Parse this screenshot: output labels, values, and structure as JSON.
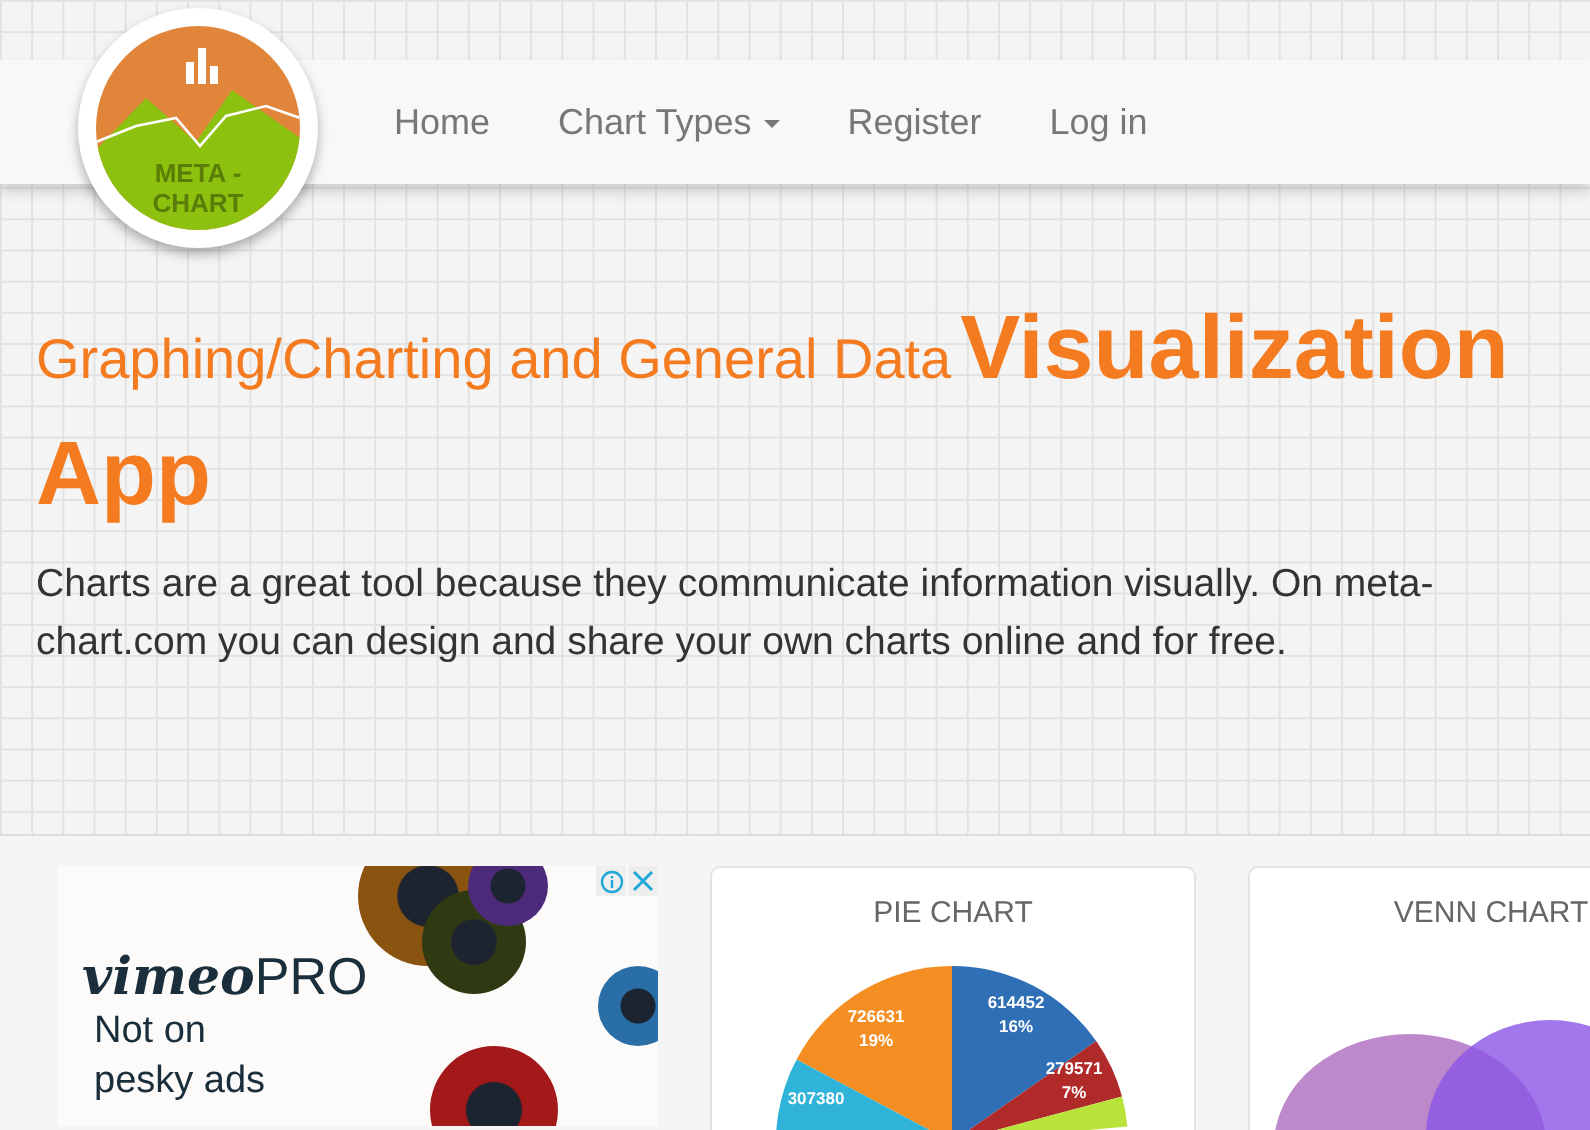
{
  "logo": {
    "text_line_1": "META -",
    "text_line_2": "CHART"
  },
  "nav": [
    {
      "label": "Home",
      "dropdown": false
    },
    {
      "label": "Chart Types",
      "dropdown": true
    },
    {
      "label": "Register",
      "dropdown": false
    },
    {
      "label": "Log in",
      "dropdown": false
    }
  ],
  "hero": {
    "subtitle": "Graphing/Charting and General Data",
    "title": "Visualization App",
    "text": "Charts are a great tool because they communicate information visually. On meta-chart.com you can design and share your own charts online and for free."
  },
  "ad": {
    "brand": "vimeo",
    "brand_suffix": "PRO",
    "text": "Not on pesky ads"
  },
  "cards": [
    {
      "title": "PIE CHART",
      "kind": "pie",
      "labels": [
        {
          "value": "726631",
          "percent": "19%"
        },
        {
          "value": "614452",
          "percent": "16%"
        },
        {
          "value": "307380"
        },
        {
          "value": "279571",
          "percent": "7%"
        }
      ]
    },
    {
      "title": "VENN CHART",
      "kind": "venn"
    }
  ]
}
